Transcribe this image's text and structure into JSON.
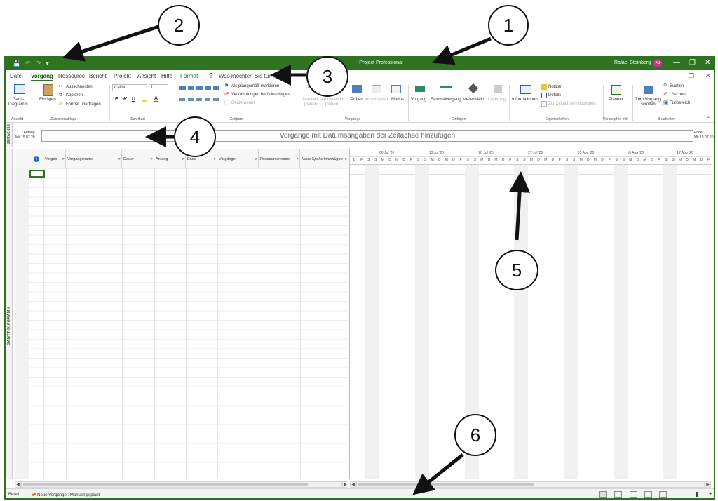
{
  "window": {
    "title": "- Project Professional",
    "user_name": "Rafael Steinberg",
    "user_initials": "RS",
    "accent_color": "#2e7420",
    "qat_icons": [
      "save-icon",
      "undo-icon",
      "redo-icon",
      "customize-qat-icon"
    ]
  },
  "menu": {
    "tabs": [
      "Datei",
      "Vorgang",
      "Ressource",
      "Bericht",
      "Projekt",
      "Ansicht",
      "Hilfe",
      "Format"
    ],
    "active_tab": "Vorgang",
    "tell_me": "Was möchten Sie tun?"
  },
  "ribbon": {
    "ansicht": {
      "button": "Gantt-Diagramm",
      "button_line1": "Gantt-",
      "button_line2": "Diagramm",
      "label": "Ansicht"
    },
    "clipboard": {
      "paste": "Einfügen",
      "cut": "Ausschneiden",
      "copy": "Kopieren",
      "format_painter": "Format übertragen",
      "label": "Zwischenablage"
    },
    "font": {
      "name": "Calibri",
      "size": "11",
      "bold": "F",
      "italic": "K",
      "underline": "U",
      "label": "Schriftart"
    },
    "schedule": {
      "mark_on_track": "Als plangemäß markieren",
      "respect_links": "Verknüpfungen berücksichtigen",
      "inactivate": "Deaktivieren",
      "label": "Zeitplan"
    },
    "tasks": {
      "manual_line1": "Manuell",
      "manual_line2": "planen",
      "auto_line1": "Automatisch",
      "auto_line2": "planen",
      "inspect": "Prüfen",
      "move": "Verschieben",
      "mode": "Modus",
      "label": "Vorgänge"
    },
    "insert": {
      "task": "Vorgang",
      "summary": "Sammelvorgang",
      "milestone": "Meilenstein",
      "deliverable": "Lieferung",
      "label": "Einfügen"
    },
    "properties": {
      "information": "Informationen",
      "notes": "Notizen",
      "details": "Details",
      "add_to_timeline": "Zur Zeitachse hinzufügen",
      "label": "Eigenschaften"
    },
    "link": {
      "planner": "Planner",
      "label": "Verknüpfen mit"
    },
    "editing": {
      "scroll_line1": "Zum Vorgang",
      "scroll_line2": "scrollen",
      "find": "Suchen",
      "clear": "Löschen",
      "fill": "Füllbereich",
      "label": "Bearbeiten"
    }
  },
  "timeline": {
    "side_label": "ZEITACHSE",
    "start_label": "Anfang",
    "start_date": "Mit 15.07.20",
    "end_label": "Ende",
    "end_date": "Mit 15.07.20",
    "placeholder": "Vorgänge mit Datumsangaben der Zeitachse hinzufügen"
  },
  "view": {
    "side_label": "GANTT-DIAGRAMM",
    "columns": [
      "Vorgan",
      "Vorgangsname",
      "Dauer",
      "Anfang",
      "Ende",
      "Vorgänger",
      "Ressourcenname",
      "Neue Spalte hinzufügen"
    ],
    "weeks": [
      "06 Jul '20",
      "13 Jul '20",
      "20 Jul '20",
      "27 Jul '20",
      "03 Aug '20",
      "10 Aug '20",
      "17 Aug '20"
    ],
    "days": [
      "D",
      "F",
      "S",
      "S",
      "M",
      "D",
      "M",
      "D",
      "F",
      "S",
      "S",
      "M",
      "D",
      "M",
      "D",
      "F",
      "S",
      "S",
      "M",
      "D",
      "M",
      "D",
      "F",
      "S",
      "S",
      "M",
      "D",
      "M",
      "D",
      "F",
      "S",
      "S",
      "M",
      "D",
      "M",
      "D",
      "F",
      "S",
      "S",
      "M",
      "D",
      "M",
      "D",
      "F",
      "S",
      "S",
      "M",
      "D",
      "M",
      "D",
      "F"
    ]
  },
  "status": {
    "ready": "Bereit",
    "new_tasks": "Neue Vorgänge : Manuell geplant"
  },
  "callouts": [
    "1",
    "2",
    "3",
    "4",
    "5",
    "6"
  ]
}
